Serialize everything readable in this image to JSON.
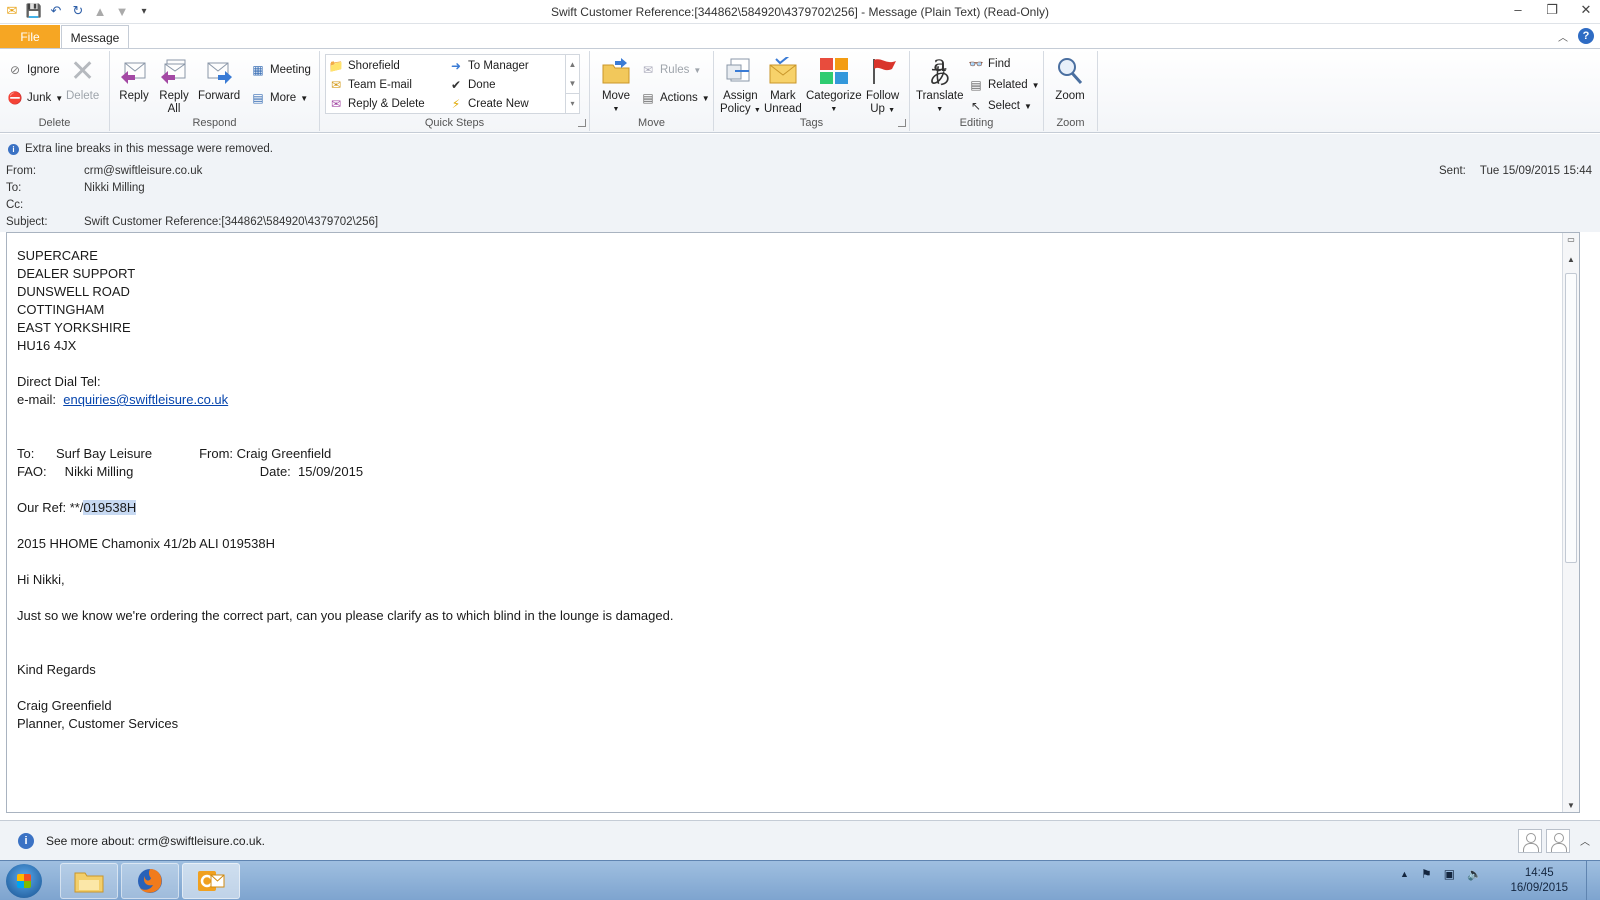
{
  "window": {
    "title": "Swift Customer Reference:[344862\\584920\\4379702\\256]  -  Message (Plain Text) (Read-Only)"
  },
  "tabs": {
    "file": "File",
    "message": "Message"
  },
  "ribbon": {
    "delete_group": {
      "label": "Delete",
      "ignore": "Ignore",
      "junk": "Junk",
      "delete": "Delete"
    },
    "respond_group": {
      "label": "Respond",
      "reply": "Reply",
      "reply_all_1": "Reply",
      "reply_all_2": "All",
      "forward": "Forward",
      "meeting": "Meeting",
      "more": "More"
    },
    "quick_steps": {
      "label": "Quick Steps",
      "items": [
        "Shorefield",
        "Team E-mail",
        "Reply & Delete",
        "To Manager",
        "Done",
        "Create New"
      ]
    },
    "move_group": {
      "label": "Move",
      "move": "Move",
      "rules": "Rules",
      "actions": "Actions"
    },
    "tags_group": {
      "label": "Tags",
      "assign_1": "Assign",
      "assign_2": "Policy",
      "mark_1": "Mark",
      "mark_2": "Unread",
      "categorize": "Categorize",
      "follow_1": "Follow",
      "follow_2": "Up"
    },
    "editing_group": {
      "label": "Editing",
      "translate": "Translate",
      "find": "Find",
      "related": "Related",
      "select": "Select"
    },
    "zoom_group": {
      "label": "Zoom",
      "zoom": "Zoom"
    }
  },
  "header": {
    "info": "Extra line breaks in this message were removed.",
    "from_label": "From:",
    "from": "crm@swiftleisure.co.uk",
    "to_label": "To:",
    "to": "Nikki Milling",
    "cc_label": "Cc:",
    "cc": "",
    "subject_label": "Subject:",
    "subject": "Swift Customer Reference:[344862\\584920\\4379702\\256]",
    "sent_label": "Sent:",
    "sent": "Tue 15/09/2015 15:44"
  },
  "body": {
    "address": [
      "SUPERCARE",
      "DEALER SUPPORT",
      "DUNSWELL ROAD",
      "COTTINGHAM",
      "EAST YORKSHIRE",
      "HU16 4JX"
    ],
    "direct_dial": "Direct Dial Tel:",
    "email_label": "e-mail:  ",
    "email_link": "enquiries@swiftleisure.co.uk",
    "to_line": "To:      Surf Bay Leisure             From: Craig Greenfield",
    "fao_line": "FAO:     Nikki Milling                                   Date:  15/09/2015",
    "ref_prefix": "Our Ref: **/",
    "ref_highlight": "019538H",
    "vehicle": "2015 HHOME Chamonix 41/2b ALI 019538H",
    "greeting": "Hi Nikki,",
    "message": "Just so we know we're ordering the correct part, can you please clarify as to which blind in the lounge is damaged.",
    "closing": "Kind Regards",
    "sig_name": "Craig Greenfield",
    "sig_title": "Planner, Customer Services"
  },
  "people_pane": {
    "text": "See more about: crm@swiftleisure.co.uk."
  },
  "taskbar": {
    "time": "14:45",
    "date": "16/09/2015"
  }
}
